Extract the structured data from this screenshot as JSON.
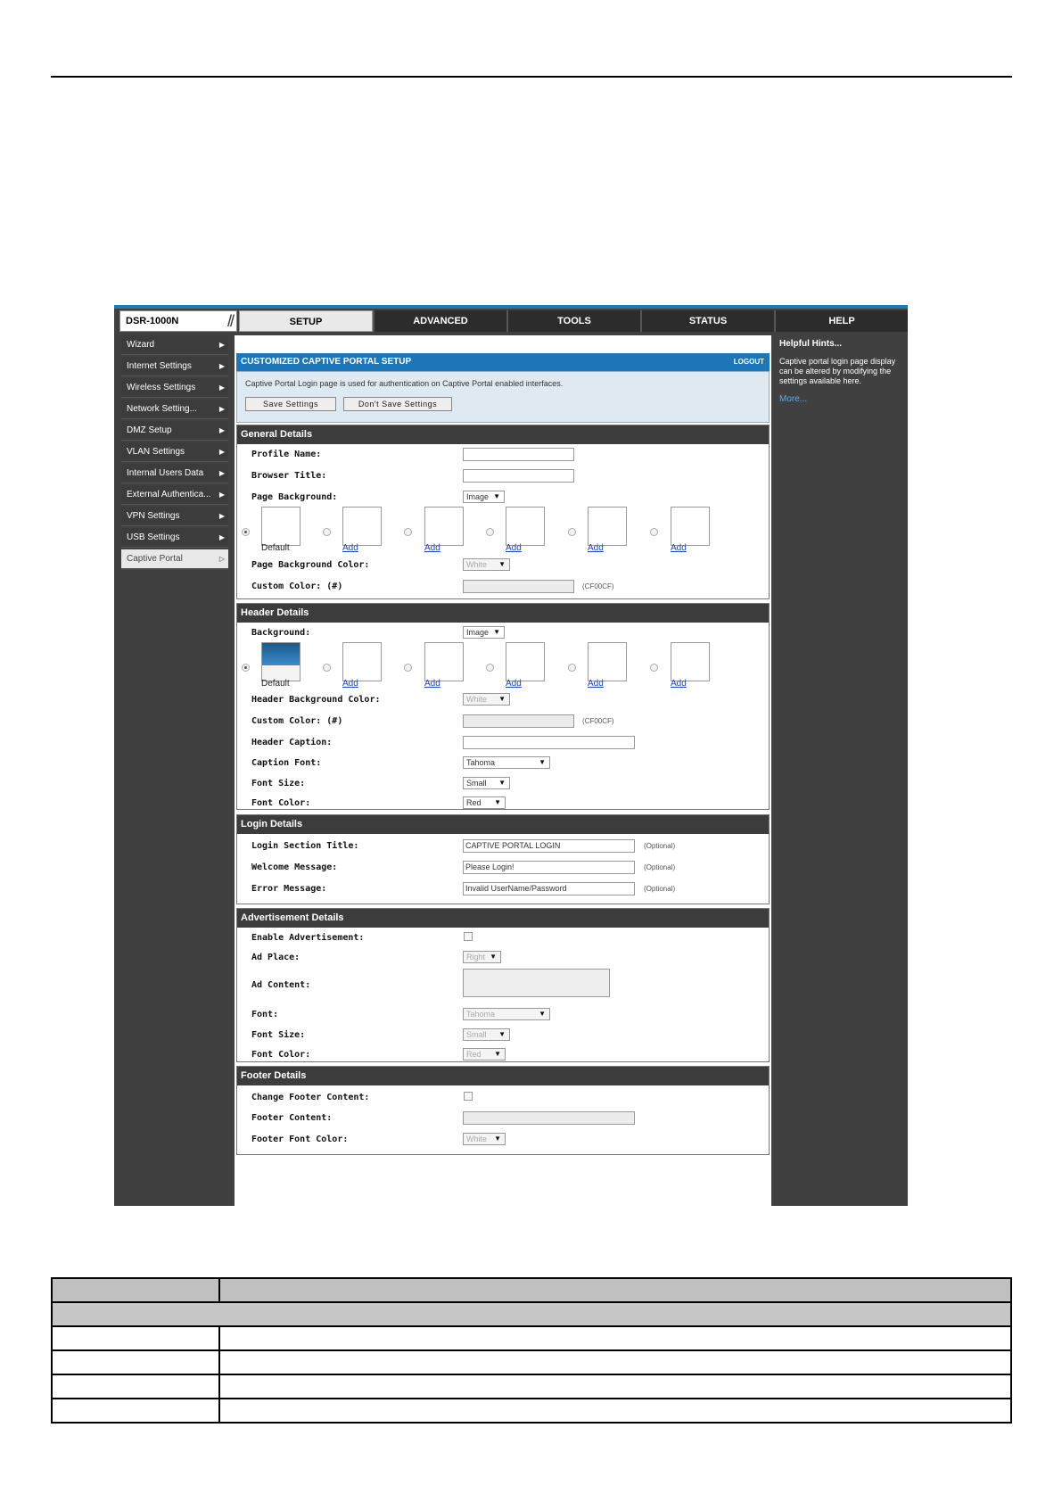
{
  "brand": {
    "model": "DSR-1000N"
  },
  "tabs": [
    "SETUP",
    "ADVANCED",
    "TOOLS",
    "STATUS",
    "HELP"
  ],
  "nav": [
    "Wizard",
    "Internet Settings",
    "Wireless Settings",
    "Network Setting...",
    "DMZ Setup",
    "VLAN Settings",
    "Internal Users Data",
    "External Authentica...",
    "VPN Settings",
    "USB Settings",
    "Captive Portal"
  ],
  "panel": {
    "title": "CUSTOMIZED CAPTIVE PORTAL SETUP",
    "logout": "LOGOUT",
    "intro": "Captive Portal Login page is used for authentication on Captive Portal enabled interfaces.",
    "save": "Save Settings",
    "dont_save": "Don't Save Settings"
  },
  "general": {
    "title": "General Details",
    "profile_name": "Profile Name:",
    "browser_title": "Browser Title:",
    "page_background": "Page Background:",
    "page_background_value": "Image",
    "default_label": "Default",
    "add": "Add",
    "bg_color": "Page Background Color:",
    "bg_color_value": "White",
    "custom_color": "Custom Color: (#)",
    "custom_hint": "(CF00CF)"
  },
  "header": {
    "title": "Header Details",
    "background": "Background:",
    "background_value": "Image",
    "default_label": "Default",
    "add": "Add",
    "bg_color": "Header Background Color:",
    "bg_color_value": "White",
    "custom_color": "Custom Color: (#)",
    "custom_hint": "(CF00CF)",
    "caption": "Header Caption:",
    "caption_font": "Caption Font:",
    "caption_font_value": "Tahoma",
    "font_size": "Font Size:",
    "font_size_value": "Small",
    "font_color": "Font Color:",
    "font_color_value": "Red"
  },
  "login": {
    "title": "Login Details",
    "section_title": "Login Section Title:",
    "section_title_value": "CAPTIVE PORTAL LOGIN",
    "welcome": "Welcome Message:",
    "welcome_value": "Please Login!",
    "error": "Error Message:",
    "error_value": "Invalid UserName/Password",
    "optional": "(Optional)"
  },
  "ad": {
    "title": "Advertisement Details",
    "enable": "Enable Advertisement:",
    "place": "Ad Place:",
    "place_value": "Right",
    "content": "Ad Content:",
    "font": "Font:",
    "font_value": "Tahoma",
    "font_size": "Font Size:",
    "font_size_value": "Small",
    "font_color": "Font Color:",
    "font_color_value": "Red"
  },
  "footer": {
    "title": "Footer Details",
    "change": "Change Footer Content:",
    "content": "Footer Content:",
    "font_color": "Footer Font Color:",
    "font_color_value": "White"
  },
  "help": {
    "title": "Helpful Hints...",
    "text": "Captive portal login page display can be altered by modifying the settings available here.",
    "more": "More..."
  },
  "colors": {
    "accent": "#1d76b8",
    "nav_bg": "#3c3c3c",
    "section_bar": "#3c3c3c"
  }
}
